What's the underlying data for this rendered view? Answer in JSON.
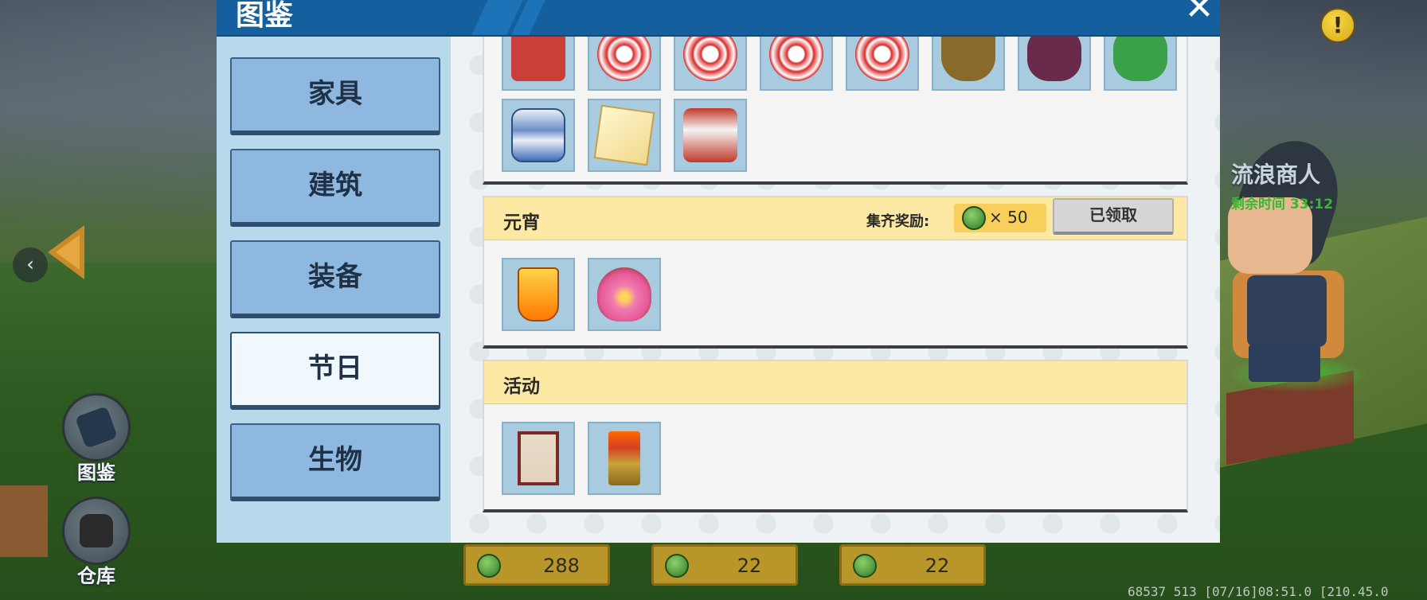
{
  "modal": {
    "title": "图鉴",
    "categories": [
      {
        "label": "家具",
        "active": false
      },
      {
        "label": "建筑",
        "active": false
      },
      {
        "label": "装备",
        "active": false
      },
      {
        "label": "节日",
        "active": true
      },
      {
        "label": "生物",
        "active": false
      }
    ],
    "sections": [
      {
        "title": "",
        "items": [
          "item-sack",
          "item-paper-cut-plate",
          "item-paper-cut-plate",
          "item-paper-cut-plate",
          "item-paper-cut-plate",
          "item-brass-bowl",
          "item-purple-cushion",
          "item-green-cushion",
          "item-porcelain-jar",
          "item-lantern-cube",
          "item-red-robe"
        ]
      },
      {
        "title": "元宵",
        "reward_label": "集齐奖励:",
        "reward_amount": "× 50",
        "claim_label": "已领取",
        "items": [
          "item-sky-lantern",
          "item-lotus-lamp"
        ]
      },
      {
        "title": "活动",
        "items": [
          "item-folding-screen",
          "item-candle-stand"
        ]
      }
    ]
  },
  "hud": {
    "codex_label": "图鉴",
    "storage_label": "仓库",
    "alert_glyph": "!",
    "back_glyph": "‹"
  },
  "npc": {
    "name": "流浪商人",
    "timer": "剩余时间 33:12"
  },
  "currency": [
    {
      "value": "288"
    },
    {
      "value": "22"
    },
    {
      "value": "22"
    }
  ],
  "debug_readout": "68537 513    [07/16]08:51.0   [210.45.0",
  "colors": {
    "header_blue": "#155f9e",
    "sidebar_bg": "#b8d9ec",
    "category_btn": "#8fb8e0",
    "section_header": "#fde9a3",
    "reward_box": "#f7cf5a",
    "npc_timer_green": "#35b932"
  }
}
